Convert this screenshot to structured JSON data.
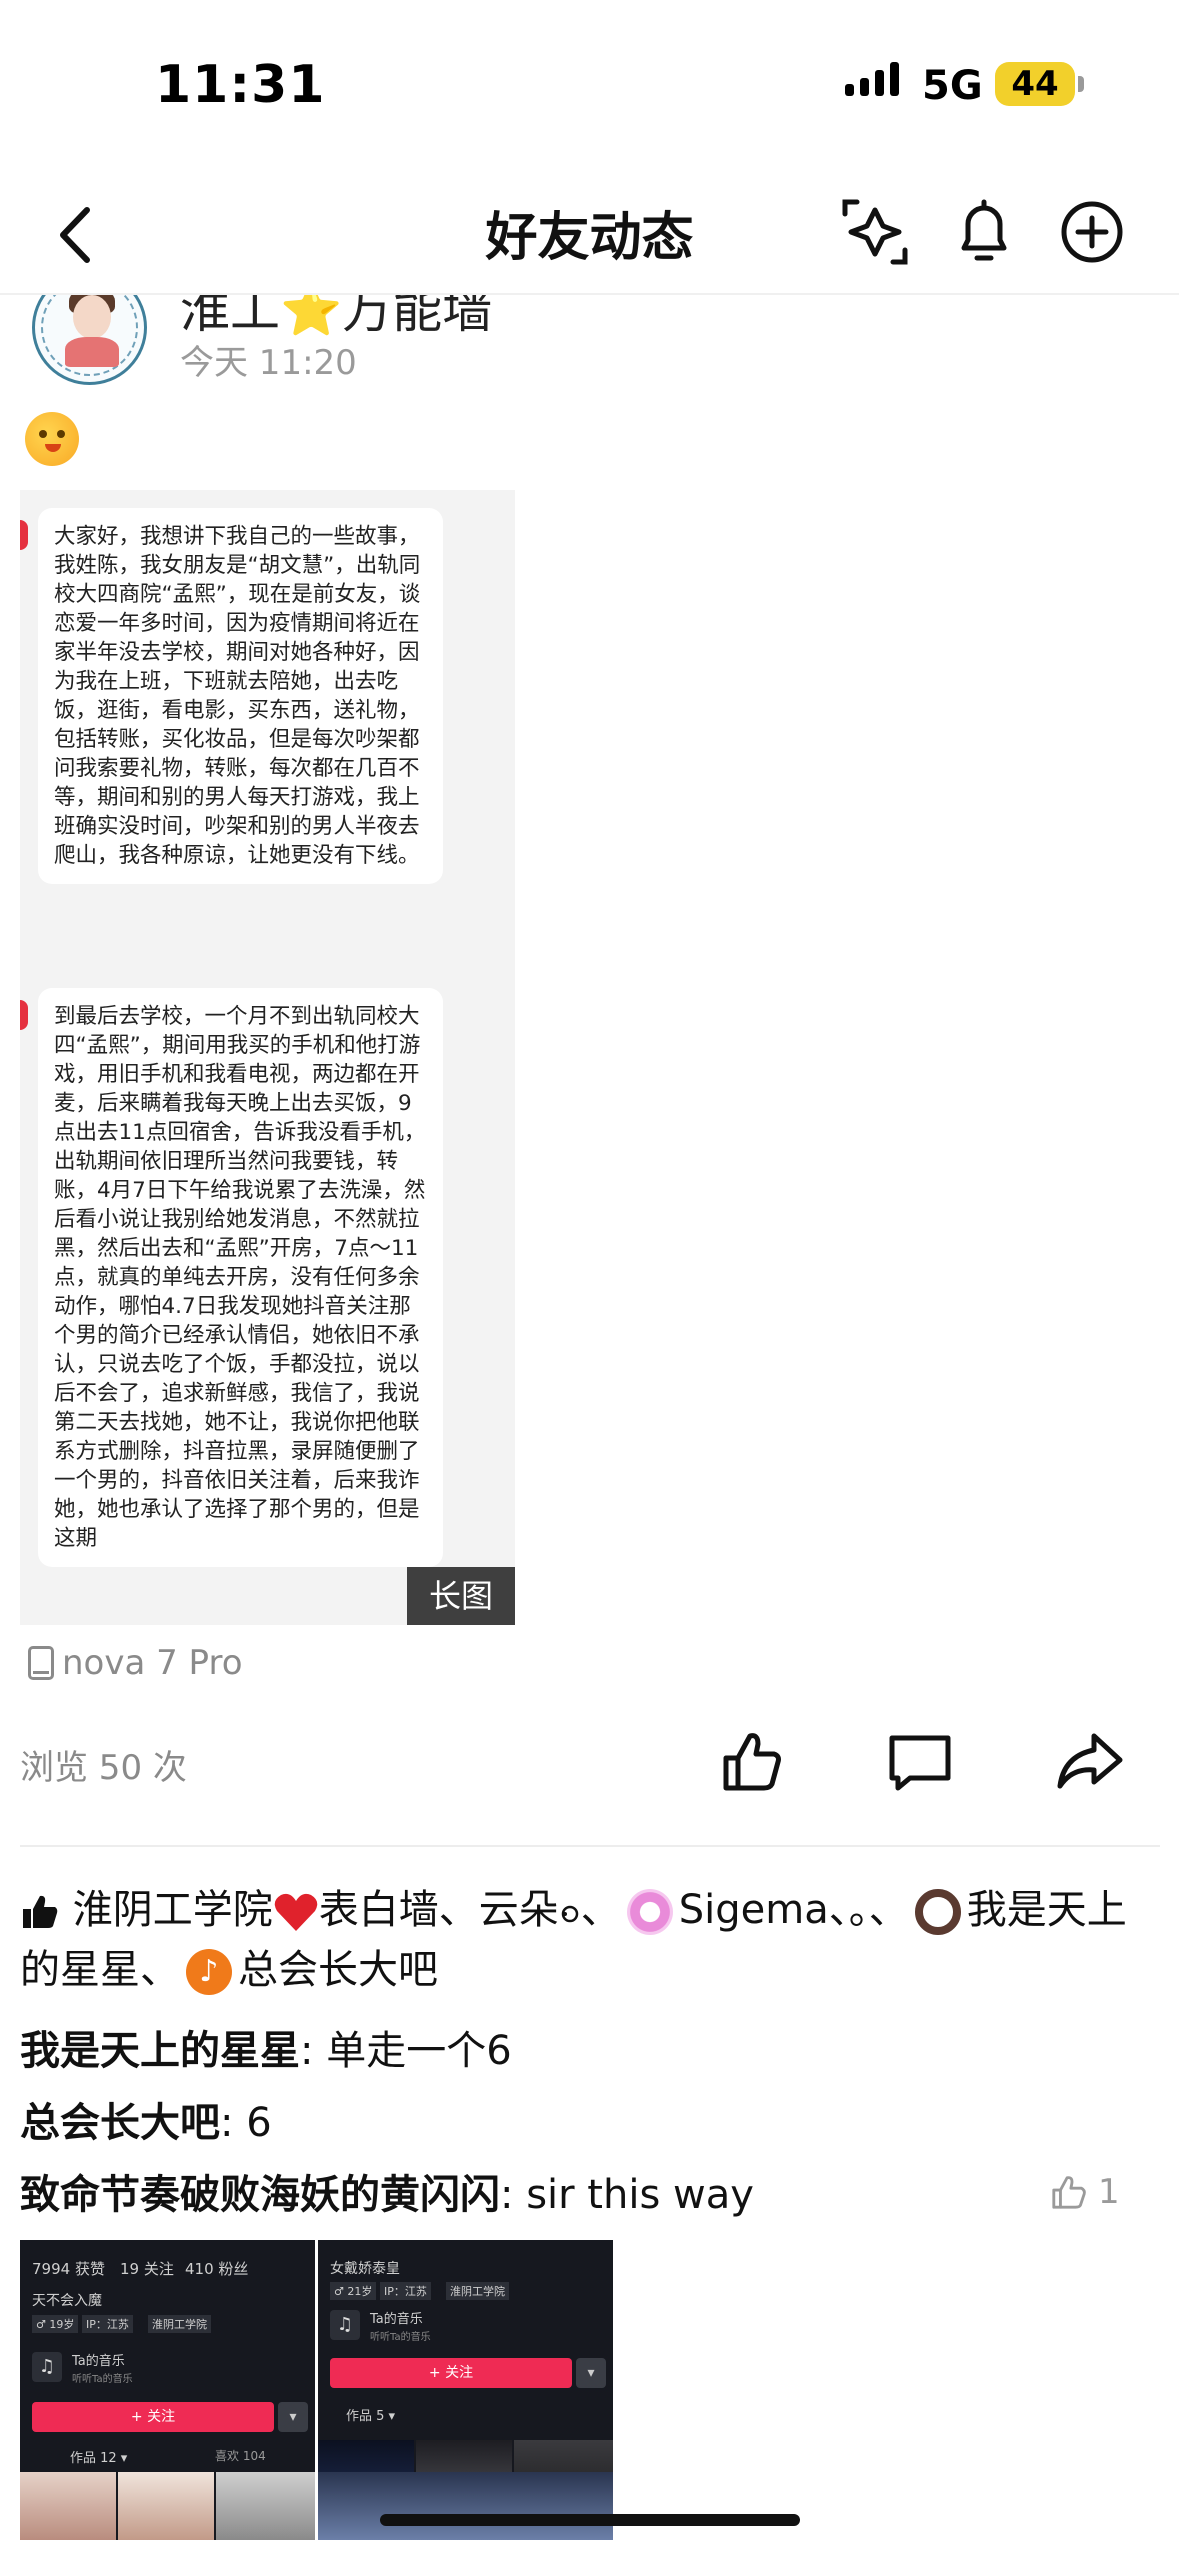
{
  "status_bar": {
    "time": "11:31",
    "network": "5G",
    "battery": "44"
  },
  "nav": {
    "title": "好友动态"
  },
  "post": {
    "author": "淮工⭐万能墙",
    "time": "今天 11:20",
    "long_image": {
      "badge": "长图",
      "paragraphs": [
        "大家好，我想讲下我自己的一些故事，我姓陈，我女朋友是“胡文慧”，出轨同校大四商院“孟熙”，现在是前女友，谈恋爱一年多时间，因为疫情期间将近在家半年没去学校，期间对她各种好，因为我在上班，下班就去陪她，出去吃饭，逛街，看电影，买东西，送礼物，包括转账，买化妆品，但是每次吵架都问我索要礼物，转账，每次都在几百不等，期间和别的男人每天打游戏，我上班确实没时间，吵架和别的男人半夜去爬山，我各种原谅，让她更没有下线。",
        "到最后去学校，一个月不到出轨同校大四“孟熙”，期间用我买的手机和他打游戏，用旧手机和我看电视，两边都在开麦，后来瞒着我每天晚上出去买饭，9点出去11点回宿舍，告诉我没看手机，出轨期间依旧理所当然问我要钱，转账，4月7日下午给我说累了去洗澡，然后看小说让我别给她发消息，不然就拉黑，然后出去和“孟熙”开房，7点～11点，就真的单纯去开房，没有任何多余动作，哪怕4.7日我发现她抖音关注那个男的简介已经承认情侣，她依旧不承认，只说去吃了个饭，手都没拉，说以后不会了，追求新鲜感，我信了，我说第二天去找她，她不让，我说你把他联系方式删除，抖音拉黑，录屏随便删了一个男的，抖音依旧关注着，后来我诈她，她也承认了选择了那个男的，但是这期"
      ]
    },
    "device": "nova 7 Pro",
    "views": "浏览 50 次"
  },
  "likes": {
    "names": [
      "淮阴工学院",
      "表白墙、云朵",
      "、",
      "Sigema、。、",
      "我是天上的星星、",
      "总会长大吧"
    ]
  },
  "comments": [
    {
      "author": "我是天上的星星",
      "text": ": 单走一个6"
    },
    {
      "author": "总会长大吧",
      "text": ": 6"
    },
    {
      "author": "致命节奏破败海妖的黄闪闪",
      "text": ": sir this way",
      "like_count": "1"
    }
  ],
  "comment_images": [
    {
      "stats": [
        "7994 获赞",
        "19 关注",
        "410 粉丝"
      ],
      "name": "天不会入魔",
      "tags": [
        "♂ 19岁",
        "IP：江苏",
        "淮阴工学院"
      ],
      "music_title": "Ta的音乐",
      "music_sub": "听听Ta的音乐",
      "follow": "+ 关注",
      "works": "作品 12 ▾",
      "likes": "喜欢 104"
    },
    {
      "name": "女戴娇泰皇",
      "tags": [
        "♂ 21岁",
        "IP：江苏",
        "淮阴工学院"
      ],
      "music_title": "Ta的音乐",
      "music_sub": "听听Ta的音乐",
      "follow": "+ 关注",
      "works": "作品 5 ▾"
    }
  ],
  "colors": {
    "like_blue": "#111111",
    "heart_red": "#e0222c",
    "follow_red": "#ef2b54",
    "battery_yellow": "#f2d02b"
  }
}
